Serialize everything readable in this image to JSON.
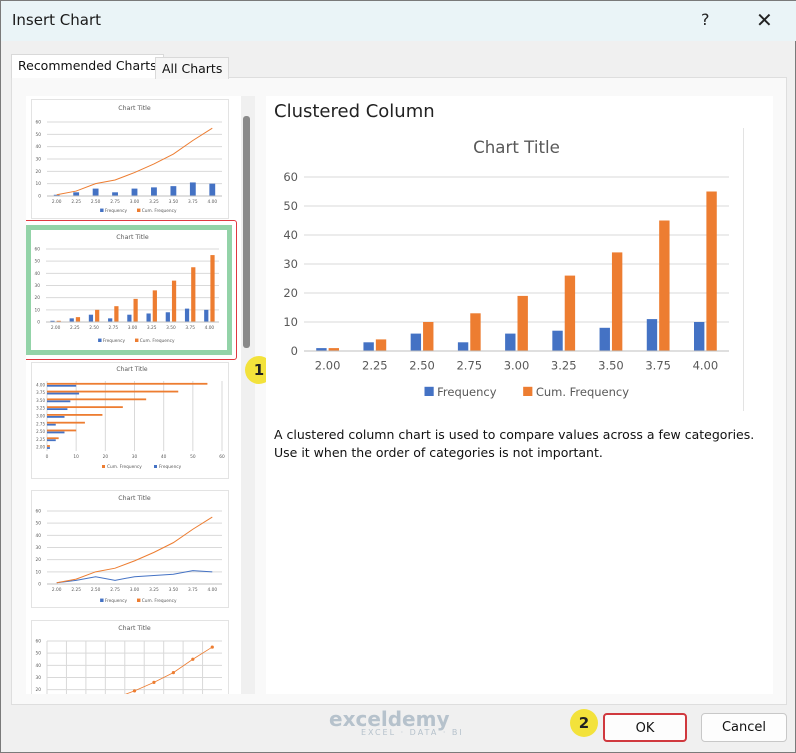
{
  "window": {
    "title": "Insert Chart",
    "help": "?",
    "close": "✕"
  },
  "tabs": [
    {
      "label": "Recommended Charts"
    },
    {
      "label": "All Charts"
    }
  ],
  "preview": {
    "heading": "Clustered Column",
    "description": "A clustered column chart is used to compare values across a few categories. Use it when the order of categories is not important."
  },
  "badges": [
    "1",
    "2"
  ],
  "buttons": {
    "ok": "OK",
    "cancel": "Cancel"
  },
  "watermark": {
    "name": "exceldemy",
    "tag": "EXCEL · DATA · BI"
  },
  "colors": {
    "frequency": "#4472c4",
    "cum": "#ed7d31"
  },
  "chart_data": {
    "type": "bar",
    "title": "Chart Title",
    "categories": [
      "2.00",
      "2.25",
      "2.50",
      "2.75",
      "3.00",
      "3.25",
      "3.50",
      "3.75",
      "4.00"
    ],
    "series": [
      {
        "name": "Frequency",
        "values": [
          1,
          3,
          6,
          3,
          6,
          7,
          8,
          11,
          10
        ]
      },
      {
        "name": "Cum. Frequency",
        "values": [
          1,
          4,
          10,
          13,
          19,
          26,
          34,
          45,
          55
        ]
      }
    ],
    "yticks": [
      "0",
      "10",
      "20",
      "30",
      "40",
      "50",
      "60"
    ],
    "ylim": [
      0,
      60
    ],
    "legend": "bottom",
    "xlabel": "",
    "ylabel": ""
  }
}
